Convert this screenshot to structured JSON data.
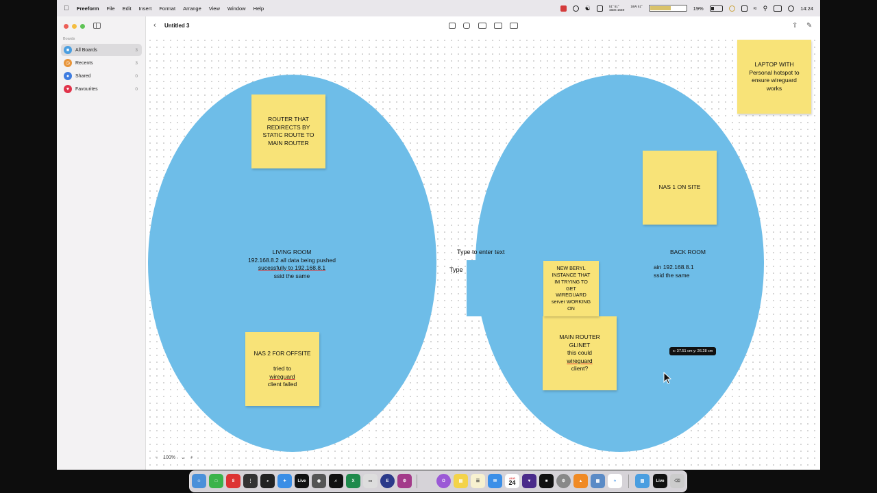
{
  "menubar": {
    "app_name": "Freeform",
    "menus": [
      "File",
      "Edit",
      "Insert",
      "Format",
      "Arrange",
      "View",
      "Window",
      "Help"
    ],
    "weather_top": "51° 51°",
    "weather_bottom": "15D6 16E9",
    "sensor_top": "18W 51°",
    "battery_percent": "19%",
    "time": "14:24"
  },
  "sidebar": {
    "heading": "Boards",
    "items": [
      {
        "label": "All Boards",
        "count": "3",
        "color": "#4a9ee0"
      },
      {
        "label": "Recents",
        "count": "3",
        "color": "#e8953a"
      },
      {
        "label": "Shared",
        "count": "0",
        "color": "#3f7de0"
      },
      {
        "label": "Favourites",
        "count": "0",
        "color": "#e0334a"
      }
    ]
  },
  "toolbar": {
    "title": "Untitled 3"
  },
  "canvas": {
    "zoom": "100%",
    "living_room": {
      "lines": [
        "LIVING ROOM",
        "192.168.8.2 all data being pushed",
        "sucessfully to 192.168.8.1",
        "ssid the same"
      ]
    },
    "back_room": {
      "line1": "BACK ROOM",
      "line2": "ain 192.168.8.1",
      "line3": "ssid the same"
    },
    "text_box_1": "Type to enter text",
    "text_box_2": "Type",
    "notes": {
      "router_static": [
        "ROUTER THAT",
        "REDIRECTS BY",
        "STATIC ROUTE TO",
        "MAIN ROUTER"
      ],
      "nas2": [
        "NAS 2 FOR OFFSITE",
        "",
        "tried to wireguard",
        "client  failed"
      ],
      "laptop": [
        "LAPTOP WITH",
        "Personal hotspot to",
        "ensure wireguard",
        "works"
      ],
      "nas1": [
        "NAS 1 ON SITE"
      ],
      "beryl": [
        "NEW BERYL",
        "INSTANCE THAT",
        "IM TRYING TO",
        "GET",
        "WIREGUARD",
        "server WORKING",
        "ON"
      ],
      "main_router": [
        "MAIN ROUTER",
        "GLINET",
        "this could wireguard",
        "client?"
      ]
    },
    "coordinate_tooltip": "x: 37.51 cm  y: 26.28 cm"
  },
  "dock": {
    "calendar_month": "AUG",
    "calendar_day": "24",
    "live_label": "Live"
  },
  "colors": {
    "room_fill": "#6ebde8",
    "sticky_note": "#f8e378",
    "accent": "#4a9ee0"
  }
}
